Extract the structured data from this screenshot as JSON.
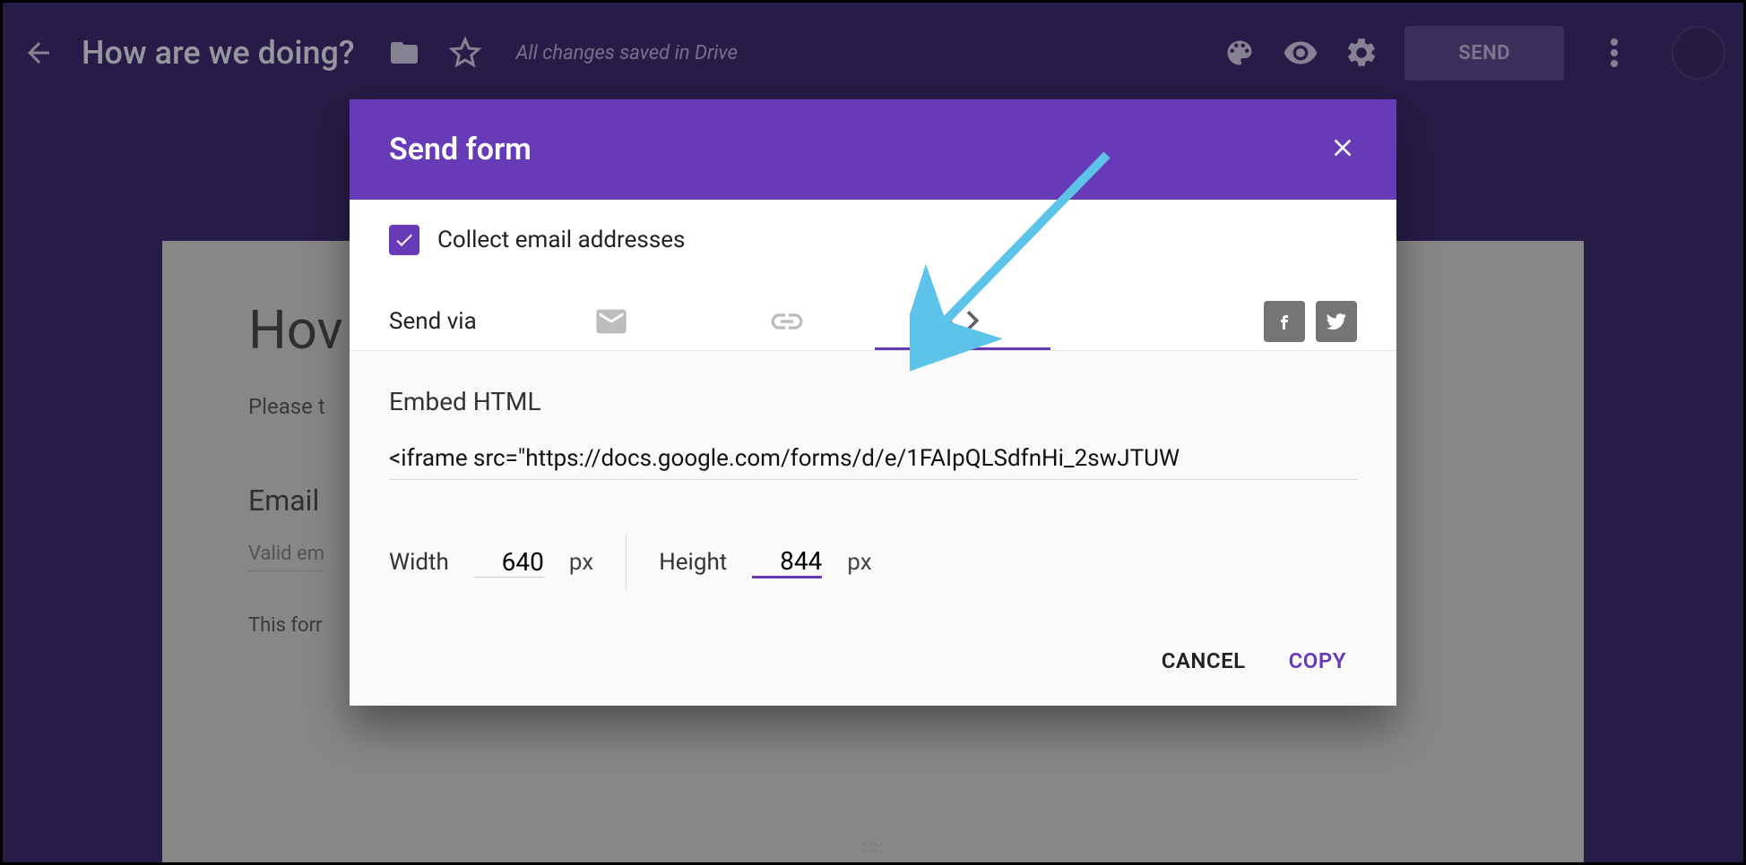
{
  "header": {
    "form_title": "How are we doing?",
    "save_status": "All changes saved in Drive",
    "send_label": "SEND"
  },
  "page_preview": {
    "title_partial": "Hov",
    "subtitle_partial": "Please t",
    "email_label_partial": "Email",
    "valid_partial": "Valid em",
    "note_partial": "This forr"
  },
  "dialog": {
    "title": "Send form",
    "collect_label": "Collect email addresses",
    "collect_checked": true,
    "send_via_label": "Send via",
    "tabs": {
      "active": "embed"
    },
    "embed": {
      "section_title": "Embed HTML",
      "iframe_code": "<iframe src=\"https://docs.google.com/forms/d/e/1FAIpQLSdfnHi_2swJTUW",
      "width_label": "Width",
      "width_value": "640",
      "height_label": "Height",
      "height_value": "844",
      "unit": "px"
    },
    "actions": {
      "cancel": "CANCEL",
      "copy": "COPY"
    }
  }
}
